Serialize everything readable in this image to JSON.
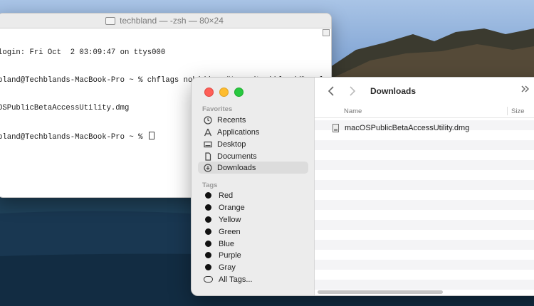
{
  "terminal": {
    "title": "techbland — -zsh — 80×24",
    "lines": [
      "login: Fri Oct  2 03:09:47 on ttys000",
      "bland@Techblands-MacBook-Pro ~ % chflags nohidden /Users/techbland/Downloads/",
      "OSPublicBetaAccessUtility.dmg",
      "bland@Techblands-MacBook-Pro ~ % "
    ]
  },
  "finder": {
    "title": "Downloads",
    "sidebar": {
      "favorites_label": "Favorites",
      "favorites": [
        {
          "label": "Recents",
          "icon": "clock-icon"
        },
        {
          "label": "Applications",
          "icon": "applications-icon"
        },
        {
          "label": "Desktop",
          "icon": "desktop-icon"
        },
        {
          "label": "Documents",
          "icon": "document-icon"
        },
        {
          "label": "Downloads",
          "icon": "download-icon",
          "selected": true
        }
      ],
      "tags_label": "Tags",
      "tags": [
        {
          "label": "Red"
        },
        {
          "label": "Orange"
        },
        {
          "label": "Yellow"
        },
        {
          "label": "Green"
        },
        {
          "label": "Blue"
        },
        {
          "label": "Purple"
        },
        {
          "label": "Gray"
        }
      ],
      "all_tags_label": "All Tags..."
    },
    "columns": {
      "name": "Name",
      "size": "Size"
    },
    "files": [
      {
        "name": "macOSPublicBetaAccessUtility.dmg",
        "icon": "dmg-file-icon"
      }
    ]
  }
}
